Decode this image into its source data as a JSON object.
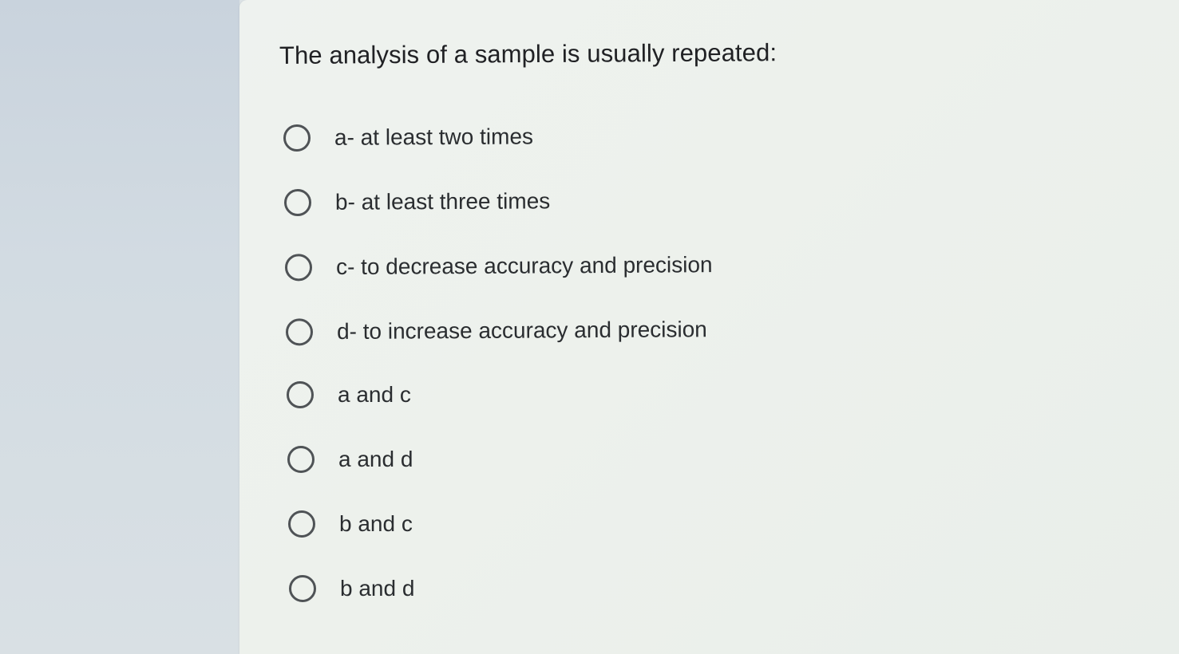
{
  "question": {
    "title": "The analysis of a sample is usually repeated:"
  },
  "options": [
    {
      "label": "a- at least two times",
      "selected": false
    },
    {
      "label": "b- at least three times",
      "selected": false
    },
    {
      "label": "c- to decrease accuracy and precision",
      "selected": false
    },
    {
      "label": "d- to increase accuracy and precision",
      "selected": false
    },
    {
      "label": "a and c",
      "selected": false
    },
    {
      "label": "a and d",
      "selected": false
    },
    {
      "label": "b and c",
      "selected": false
    },
    {
      "label": "b and d",
      "selected": false
    }
  ],
  "colors": {
    "radio_border": "#4f5356",
    "text": "#202124",
    "card_background": "#edf1ec"
  },
  "icons": {
    "radio": "radio-unchecked-icon"
  }
}
